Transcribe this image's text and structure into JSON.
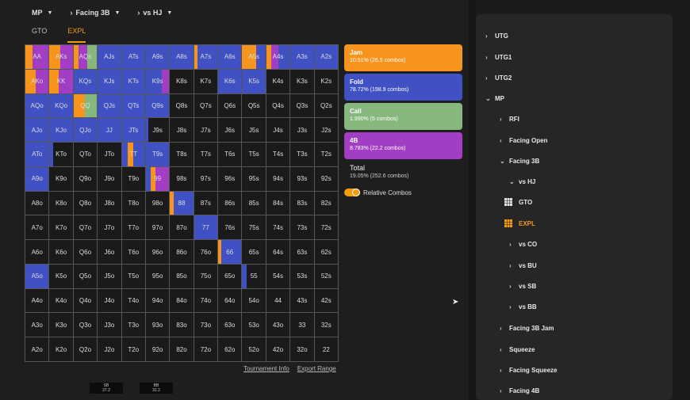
{
  "header": {
    "position": "MP",
    "scenario": "Facing 3B",
    "opponent": "vs HJ"
  },
  "tabs": [
    {
      "label": "GTO",
      "active": false
    },
    {
      "label": "EXPL",
      "active": true
    }
  ],
  "colors": {
    "jam": "#f7941d",
    "fold": "#3f51c3",
    "call": "#86b87d",
    "fourbet": "#a23ec3",
    "empty": "#1a1a1a"
  },
  "grid": {
    "rows": [
      [
        "AA",
        "AKs",
        "AQs",
        "AJs",
        "ATs",
        "A9s",
        "A8s",
        "A7s",
        "A6s",
        "A5s",
        "A4s",
        "A3s",
        "A2s"
      ],
      [
        "AKo",
        "KK",
        "KQs",
        "KJs",
        "KTs",
        "K9s",
        "K8s",
        "K7s",
        "K6s",
        "K5s",
        "K4s",
        "K3s",
        "K2s"
      ],
      [
        "AQo",
        "KQo",
        "QQ",
        "QJs",
        "QTs",
        "Q9s",
        "Q8s",
        "Q7s",
        "Q6s",
        "Q5s",
        "Q4s",
        "Q3s",
        "Q2s"
      ],
      [
        "AJo",
        "KJo",
        "QJo",
        "JJ",
        "JTs",
        "J9s",
        "J8s",
        "J7s",
        "J6s",
        "J5s",
        "J4s",
        "J3s",
        "J2s"
      ],
      [
        "ATo",
        "KTo",
        "QTo",
        "JTo",
        "TT",
        "T9s",
        "T8s",
        "T7s",
        "T6s",
        "T5s",
        "T4s",
        "T3s",
        "T2s"
      ],
      [
        "A9o",
        "K9o",
        "Q9o",
        "J9o",
        "T9o",
        "99",
        "98s",
        "97s",
        "96s",
        "95s",
        "94s",
        "93s",
        "92s"
      ],
      [
        "A8o",
        "K8o",
        "Q8o",
        "J8o",
        "T8o",
        "98o",
        "88",
        "87s",
        "86s",
        "85s",
        "84s",
        "83s",
        "82s"
      ],
      [
        "A7o",
        "K7o",
        "Q7o",
        "J7o",
        "T7o",
        "97o",
        "87o",
        "77",
        "76s",
        "75s",
        "74s",
        "73s",
        "72s"
      ],
      [
        "A6o",
        "K6o",
        "Q6o",
        "J6o",
        "T6o",
        "96o",
        "86o",
        "76o",
        "66",
        "65s",
        "64s",
        "63s",
        "62s"
      ],
      [
        "A5o",
        "K5o",
        "Q5o",
        "J5o",
        "T5o",
        "95o",
        "85o",
        "75o",
        "65o",
        "55",
        "54s",
        "53s",
        "52s"
      ],
      [
        "A4o",
        "K4o",
        "Q4o",
        "J4o",
        "T4o",
        "94o",
        "84o",
        "74o",
        "64o",
        "54o",
        "44",
        "43s",
        "42s"
      ],
      [
        "A3o",
        "K3o",
        "Q3o",
        "J3o",
        "T3o",
        "93o",
        "83o",
        "73o",
        "63o",
        "53o",
        "43o",
        "33",
        "32s"
      ],
      [
        "A2o",
        "K2o",
        "Q2o",
        "J2o",
        "T2o",
        "92o",
        "82o",
        "72o",
        "62o",
        "52o",
        "42o",
        "32o",
        "22"
      ]
    ],
    "mix": {
      "AA": [
        [
          "jam",
          30
        ],
        [
          "fourbet",
          70
        ]
      ],
      "AKs": [
        [
          "jam",
          45
        ],
        [
          "fourbet",
          55
        ]
      ],
      "AQs": [
        [
          "jam",
          20
        ],
        [
          "fourbet",
          40
        ],
        [
          "call",
          40
        ]
      ],
      "AJs": [
        [
          "fold",
          100
        ]
      ],
      "ATs": [
        [
          "fold",
          100
        ]
      ],
      "A9s": [
        [
          "fold",
          100
        ]
      ],
      "A8s": [
        [
          "fold",
          100
        ]
      ],
      "A7s": [
        [
          "jam",
          15
        ],
        [
          "fold",
          85
        ]
      ],
      "A6s": [
        [
          "fold",
          100
        ]
      ],
      "A5s": [
        [
          "jam",
          60
        ],
        [
          "fold",
          40
        ]
      ],
      "A4s": [
        [
          "jam",
          20
        ],
        [
          "fourbet",
          30
        ],
        [
          "fold",
          50
        ]
      ],
      "A3s": [
        [
          "fold",
          100
        ]
      ],
      "A2s": [
        [
          "fold",
          100
        ]
      ],
      "AKo": [
        [
          "jam",
          45
        ],
        [
          "fourbet",
          55
        ]
      ],
      "KK": [
        [
          "jam",
          40
        ],
        [
          "fourbet",
          60
        ]
      ],
      "KQs": [
        [
          "fold",
          100
        ]
      ],
      "KJs": [
        [
          "fold",
          100
        ]
      ],
      "KTs": [
        [
          "fold",
          100
        ]
      ],
      "K9s": [
        [
          "fold",
          70
        ],
        [
          "fourbet",
          30
        ]
      ],
      "K6s": [
        [
          "fold",
          100
        ]
      ],
      "K5s": [
        [
          "fold",
          100
        ]
      ],
      "AQo": [
        [
          "fold",
          100
        ]
      ],
      "KQo": [
        [
          "fold",
          100
        ]
      ],
      "QQ": [
        [
          "jam",
          50
        ],
        [
          "call",
          50
        ]
      ],
      "QJs": [
        [
          "fold",
          100
        ]
      ],
      "QTs": [
        [
          "fold",
          100
        ]
      ],
      "Q9s": [
        [
          "fold",
          100
        ]
      ],
      "AJo": [
        [
          "fold",
          100
        ]
      ],
      "KJo": [
        [
          "fold",
          100
        ]
      ],
      "QJo": [
        [
          "fold",
          100
        ]
      ],
      "JJ": [
        [
          "fold",
          100
        ]
      ],
      "JTs": [
        [
          "fold",
          100
        ]
      ],
      "J9s": [
        [
          "fold",
          12
        ]
      ],
      "ATo": [
        [
          "fold",
          100
        ]
      ],
      "KTo": [
        [
          "fold",
          15
        ]
      ],
      "TT": [
        [
          "fold",
          25
        ],
        [
          "jam",
          25
        ],
        [
          "fold",
          50
        ]
      ],
      "T9s": [
        [
          "fold",
          100
        ]
      ],
      "A9o": [
        [
          "fold",
          100
        ]
      ],
      "99": [
        [
          "fold",
          20
        ],
        [
          "jam",
          20
        ],
        [
          "fourbet",
          60
        ]
      ],
      "88": [
        [
          "jam",
          15
        ],
        [
          "fold",
          85
        ]
      ],
      "77": [
        [
          "fold",
          100
        ]
      ],
      "66": [
        [
          "jam",
          12
        ],
        [
          "fold",
          88
        ]
      ],
      "A5o": [
        [
          "fold",
          100
        ]
      ],
      "55": [
        [
          "fold",
          20
        ]
      ]
    }
  },
  "actions": [
    {
      "key": "jam",
      "label": "Jam",
      "detail": "10.51% (26.5 combos)"
    },
    {
      "key": "fold",
      "label": "Fold",
      "detail": "78.72% (198.9 combos)"
    },
    {
      "key": "call",
      "label": "Call",
      "detail": "1.990% (5 combos)"
    },
    {
      "key": "fourbet",
      "label": "4B",
      "detail": "8.783% (22.2 combos)"
    }
  ],
  "total": {
    "label": "Total",
    "detail": "19.05% (252.6 combos)"
  },
  "toggle": {
    "label": "Relative Combos",
    "on": true
  },
  "links": {
    "tournament_info": "Tournament Info",
    "export_range": "Export Range"
  },
  "stacks": [
    {
      "pos": "SB",
      "value": "27.2"
    },
    {
      "pos": "BB",
      "value": "31.2"
    }
  ],
  "tree": [
    {
      "label": "UTG",
      "chev": "›",
      "indent": 0
    },
    {
      "label": "UTG1",
      "chev": "›",
      "indent": 0
    },
    {
      "label": "UTG2",
      "chev": "›",
      "indent": 0
    },
    {
      "label": "MP",
      "chev": "⌄",
      "indent": 0
    },
    {
      "label": "RFI",
      "chev": "›",
      "indent": 1
    },
    {
      "label": "Facing Open",
      "chev": "›",
      "indent": 1
    },
    {
      "label": "Facing 3B",
      "chev": "⌄",
      "indent": 1
    },
    {
      "label": "vs HJ",
      "chev": "⌄",
      "indent": 2
    },
    {
      "label": "GTO",
      "chev": "grid",
      "indent": 2,
      "active": false
    },
    {
      "label": "EXPL",
      "chev": "grid",
      "indent": 2,
      "active": true
    },
    {
      "label": "vs CO",
      "chev": "›",
      "indent": 2
    },
    {
      "label": "vs BU",
      "chev": "›",
      "indent": 2
    },
    {
      "label": "vs SB",
      "chev": "›",
      "indent": 2
    },
    {
      "label": "vs BB",
      "chev": "›",
      "indent": 2
    },
    {
      "label": "Facing 3B Jam",
      "chev": "›",
      "indent": 1
    },
    {
      "label": "Squeeze",
      "chev": "›",
      "indent": 1
    },
    {
      "label": "Facing Squeeze",
      "chev": "›",
      "indent": 1
    },
    {
      "label": "Facing 4B",
      "chev": "›",
      "indent": 1
    }
  ]
}
